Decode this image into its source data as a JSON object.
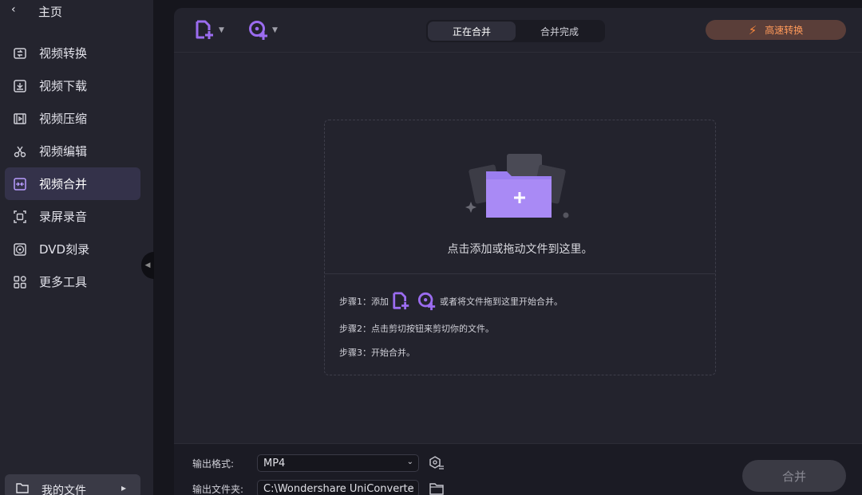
{
  "sidebar": {
    "home_label": "主页",
    "items": [
      {
        "label": "视频转换",
        "icon": "convert-icon"
      },
      {
        "label": "视频下载",
        "icon": "download-icon"
      },
      {
        "label": "视频压缩",
        "icon": "compress-icon"
      },
      {
        "label": "视频编辑",
        "icon": "scissors-icon"
      },
      {
        "label": "视频合并",
        "icon": "merge-icon",
        "active": true
      },
      {
        "label": "录屏录音",
        "icon": "screen-record-icon"
      },
      {
        "label": "DVD刻录",
        "icon": "disc-icon"
      },
      {
        "label": "更多工具",
        "icon": "grid-icon"
      }
    ],
    "my_files_label": "我的文件"
  },
  "toolbar": {
    "tabs": [
      "正在合并",
      "合并完成"
    ],
    "active_tab": "正在合并",
    "fast_convert_label": "高速转换"
  },
  "dropzone": {
    "prompt": "点击添加或拖动文件到这里。",
    "step1_prefix": "步骤1：添加",
    "step1_suffix": "或者将文件拖到这里开始合并。",
    "step2": "步骤2：点击剪切按钮来剪切你的文件。",
    "step3": "步骤3：开始合并。"
  },
  "footer": {
    "format_label": "输出格式:",
    "format_value": "MP4",
    "folder_label": "输出文件夹:",
    "folder_value": "C:\\Wondershare UniConverte",
    "merge_label": "合并"
  },
  "colors": {
    "accent_purple": "#9b6cf0",
    "fast_orange": "#ff9a5a"
  }
}
